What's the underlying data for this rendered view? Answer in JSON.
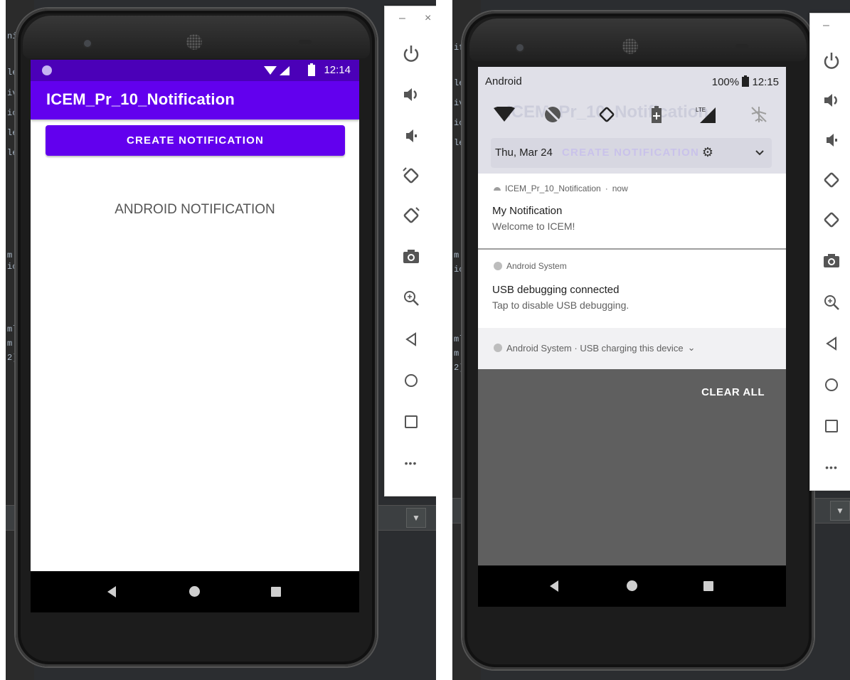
{
  "left": {
    "status_time": "12:14",
    "app_title": "ICEM_Pr_10_Notification",
    "create_button_label": "CREATE NOTIFICATION",
    "center_text": "ANDROID NOTIFICATION"
  },
  "right": {
    "carrier": "Android",
    "battery": "100%",
    "status_time": "12:15",
    "ghost_title": "ICEM_Pr_10_Notification",
    "ghost_button": "CREATE NOTIFICATION",
    "date": "Thu, Mar 24",
    "lte_label": "LTE",
    "notif1": {
      "app": "ICEM_Pr_10_Notification",
      "sep": "·",
      "time": "now",
      "title": "My Notification",
      "text": "Welcome to ICEM!"
    },
    "notif2": {
      "app": "Android System",
      "title": "USB debugging connected",
      "text": "Tap to disable USB debugging."
    },
    "notif3": {
      "summary": "Android System · USB charging this device",
      "chevron": "⌄"
    },
    "clear_all": "CLEAR ALL"
  },
  "toolbar": {
    "minimize": "–",
    "close": "×",
    "more": "•••"
  },
  "icons": [
    "power-icon",
    "volume-up-icon",
    "volume-down-icon",
    "rotate-left-icon",
    "rotate-right-icon",
    "camera-icon",
    "zoom-icon",
    "back-icon",
    "home-icon",
    "overview-icon",
    "more-icon"
  ],
  "colors": {
    "primary": "#6200ee",
    "primary_dark": "#4b00b8",
    "ide_background": "#2b2d30"
  }
}
